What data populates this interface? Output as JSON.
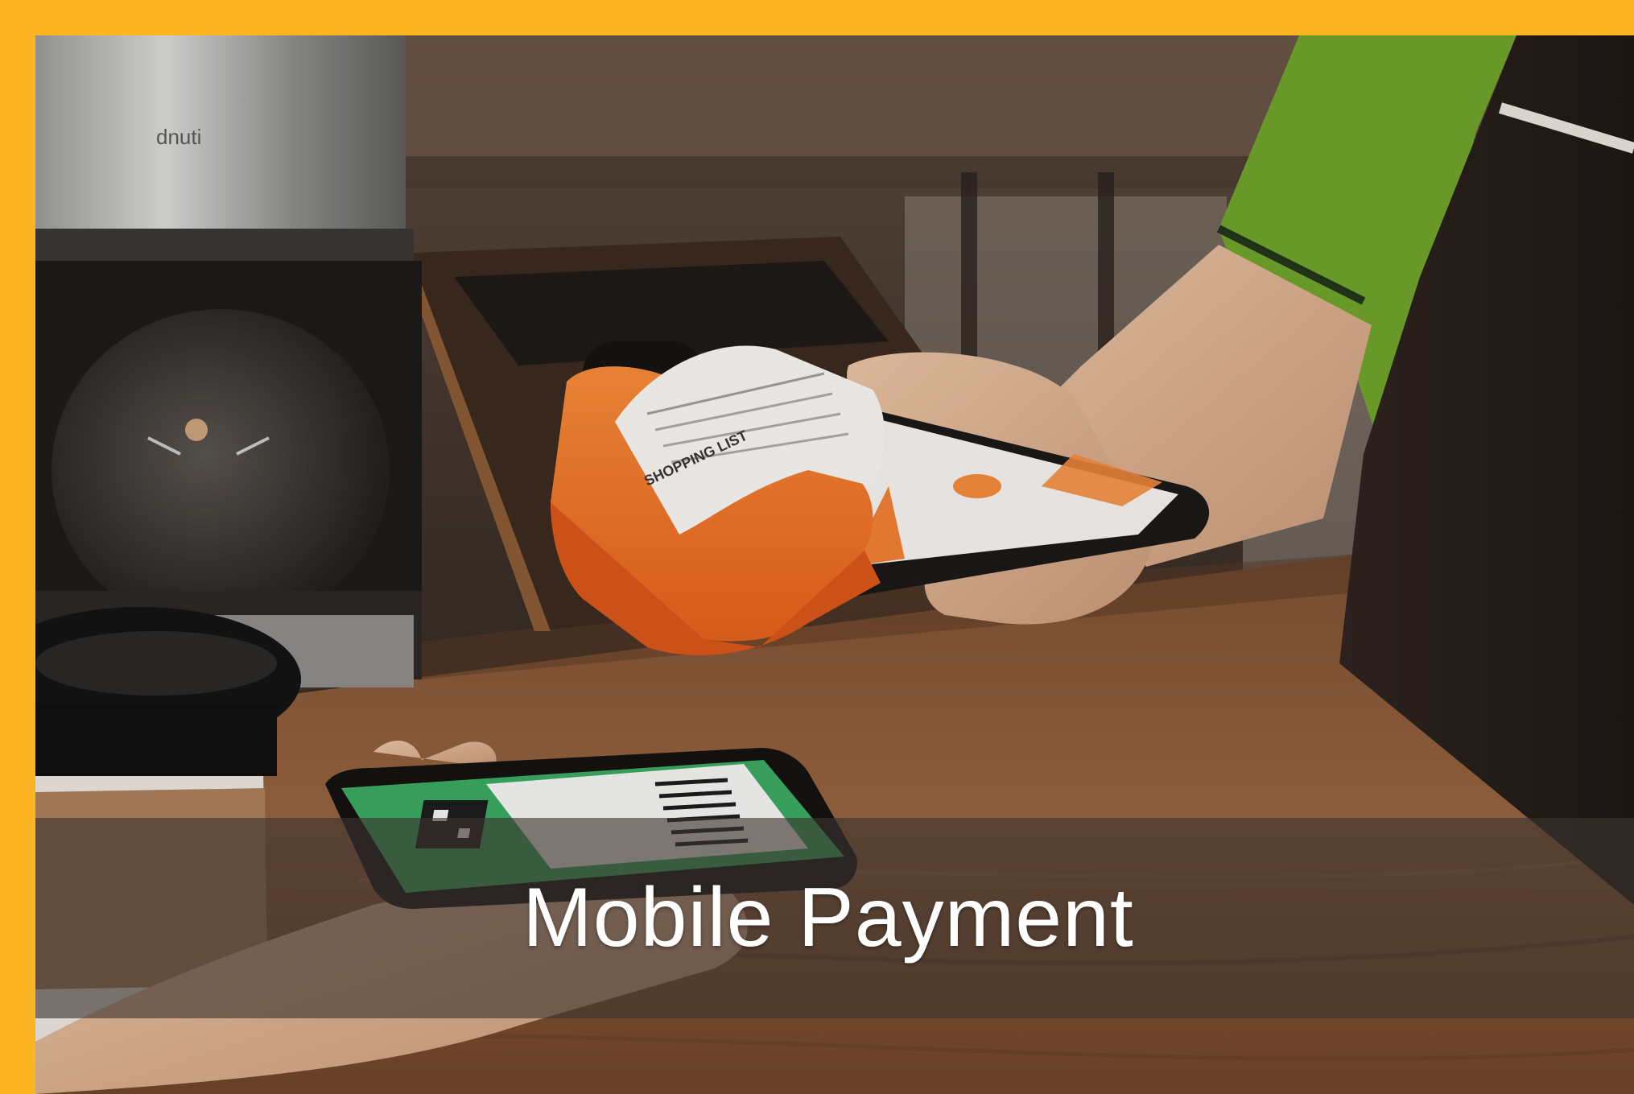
{
  "caption": {
    "title": "Mobile Payment"
  },
  "scene": {
    "coffee_maker_brand": "dnuti",
    "receipt_heading": "SHOPPING LIST"
  },
  "colors": {
    "frame": "#fbb522",
    "printer_orange": "#f2772a",
    "shirt_green": "#6fa32b",
    "wood_table": "#8a5a3a",
    "phone_screen_green": "#3aa860",
    "caption_band": "rgba(60,52,46,0.62)"
  }
}
